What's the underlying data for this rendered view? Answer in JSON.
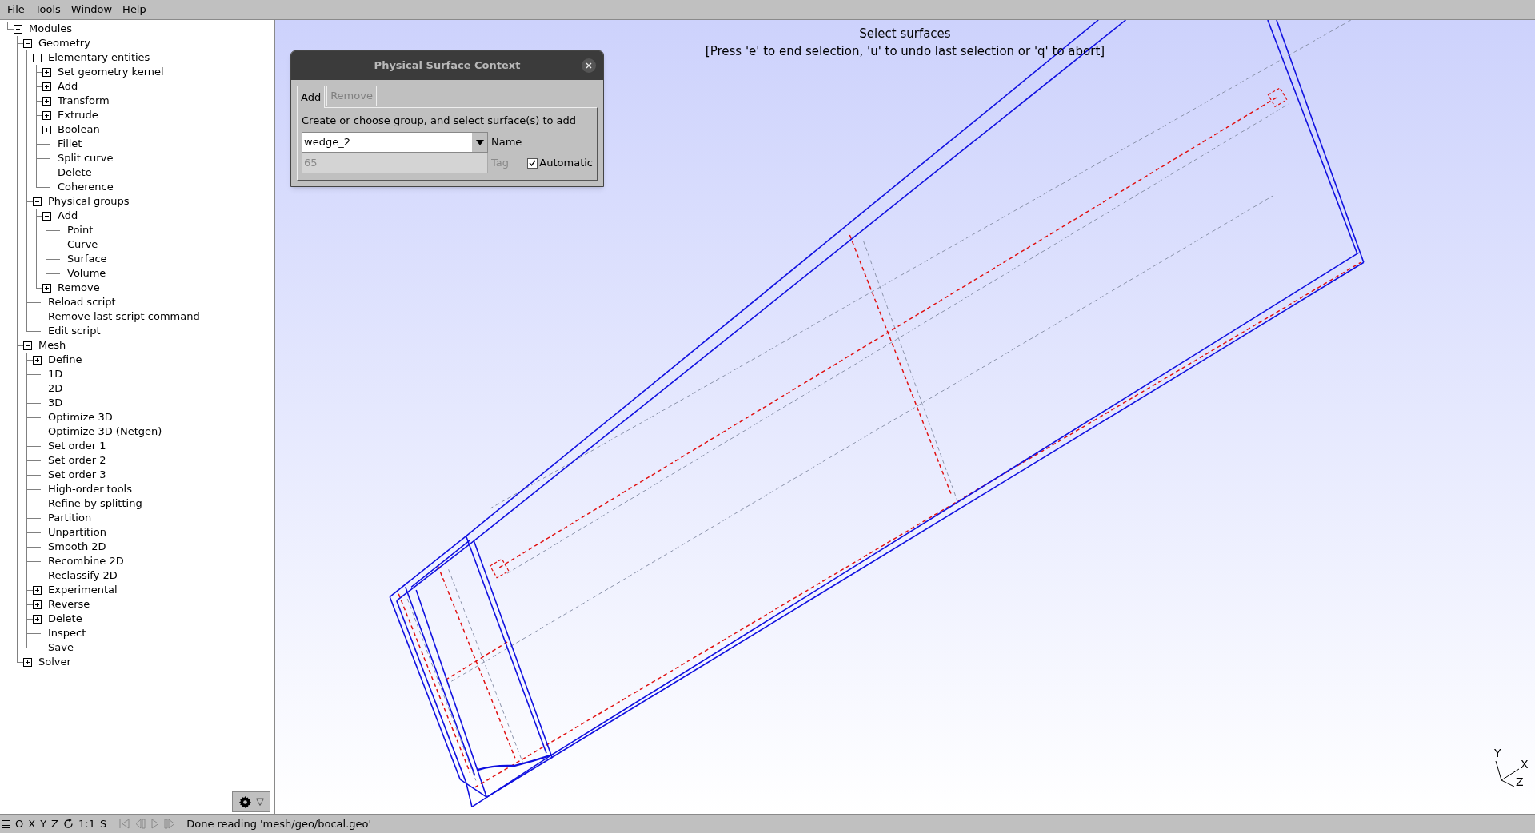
{
  "menu_bar": [
    "File",
    "Tools",
    "Window",
    "Help"
  ],
  "tree": [
    {
      "label": "Modules",
      "expanded": true,
      "children": [
        {
          "label": "Geometry",
          "expanded": true,
          "children": [
            {
              "label": "Elementary entities",
              "expanded": true,
              "children": [
                {
                  "label": "Set geometry kernel",
                  "expanded": false
                },
                {
                  "label": "Add",
                  "expanded": false
                },
                {
                  "label": "Transform",
                  "expanded": false
                },
                {
                  "label": "Extrude",
                  "expanded": false
                },
                {
                  "label": "Boolean",
                  "expanded": false
                },
                {
                  "label": "Fillet"
                },
                {
                  "label": "Split curve"
                },
                {
                  "label": "Delete"
                },
                {
                  "label": "Coherence"
                }
              ]
            },
            {
              "label": "Physical groups",
              "expanded": true,
              "children": [
                {
                  "label": "Add",
                  "expanded": true,
                  "children": [
                    {
                      "label": "Point"
                    },
                    {
                      "label": "Curve"
                    },
                    {
                      "label": "Surface"
                    },
                    {
                      "label": "Volume"
                    }
                  ]
                },
                {
                  "label": "Remove",
                  "expanded": false
                }
              ]
            },
            {
              "label": "Reload script"
            },
            {
              "label": "Remove last script command"
            },
            {
              "label": "Edit script"
            }
          ]
        },
        {
          "label": "Mesh",
          "expanded": true,
          "children": [
            {
              "label": "Define",
              "expanded": false
            },
            {
              "label": "1D"
            },
            {
              "label": "2D"
            },
            {
              "label": "3D"
            },
            {
              "label": "Optimize 3D"
            },
            {
              "label": "Optimize 3D (Netgen)"
            },
            {
              "label": "Set order 1"
            },
            {
              "label": "Set order 2"
            },
            {
              "label": "Set order 3"
            },
            {
              "label": "High-order tools"
            },
            {
              "label": "Refine by splitting"
            },
            {
              "label": "Partition"
            },
            {
              "label": "Unpartition"
            },
            {
              "label": "Smooth 2D"
            },
            {
              "label": "Recombine 2D"
            },
            {
              "label": "Reclassify 2D"
            },
            {
              "label": "Experimental",
              "expanded": false
            },
            {
              "label": "Reverse",
              "expanded": false
            },
            {
              "label": "Delete",
              "expanded": false
            },
            {
              "label": "Inspect"
            },
            {
              "label": "Save"
            }
          ]
        },
        {
          "label": "Solver",
          "expanded": false
        }
      ]
    }
  ],
  "viewport": {
    "message": "Select surfaces",
    "hint": "[Press 'e' to end selection, 'u' to undo last selection or 'q' to abort]",
    "axes": [
      "Y",
      "X",
      "Z"
    ]
  },
  "dialog": {
    "title": "Physical Surface Context",
    "tabs": [
      {
        "label": "Add",
        "selected": true
      },
      {
        "label": "Remove",
        "selected": false
      }
    ],
    "instruction": "Create or choose group, and select surface(s) to add",
    "name_field": {
      "value": "wedge_2",
      "label": "Name"
    },
    "tag_field": {
      "value": "65",
      "label": "Tag",
      "disabled": true
    },
    "automatic": {
      "label": "Automatic",
      "checked": true
    }
  },
  "status_bar": {
    "buttons": [
      "O",
      "X",
      "Y",
      "Z",
      "1:1",
      "S"
    ],
    "message": "Done reading 'mesh/geo/bocal.geo'"
  }
}
